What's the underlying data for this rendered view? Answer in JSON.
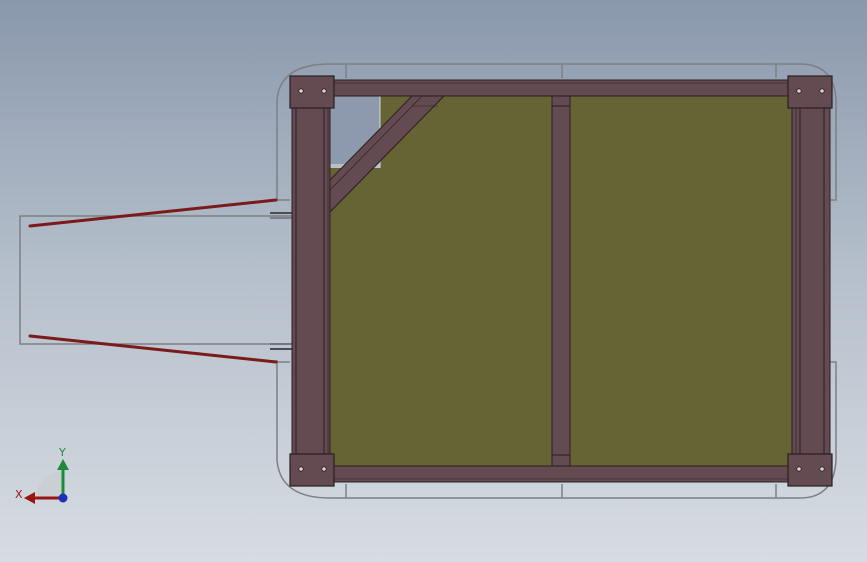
{
  "viewport": {
    "background_top": "#8a98ac",
    "background_bottom": "#d7dce2"
  },
  "model": {
    "frame_color": "#634b51",
    "frame_edge_color": "#2a1e22",
    "panel_color": "#666434",
    "outline_color": "#7d7f84",
    "towbar_color": "#7a1a1a"
  },
  "triad": {
    "x_label": "X",
    "y_label": "Y",
    "x_color": "#9b1414",
    "y_color": "#1c8a3a",
    "z_color": "#1b2fb8"
  }
}
